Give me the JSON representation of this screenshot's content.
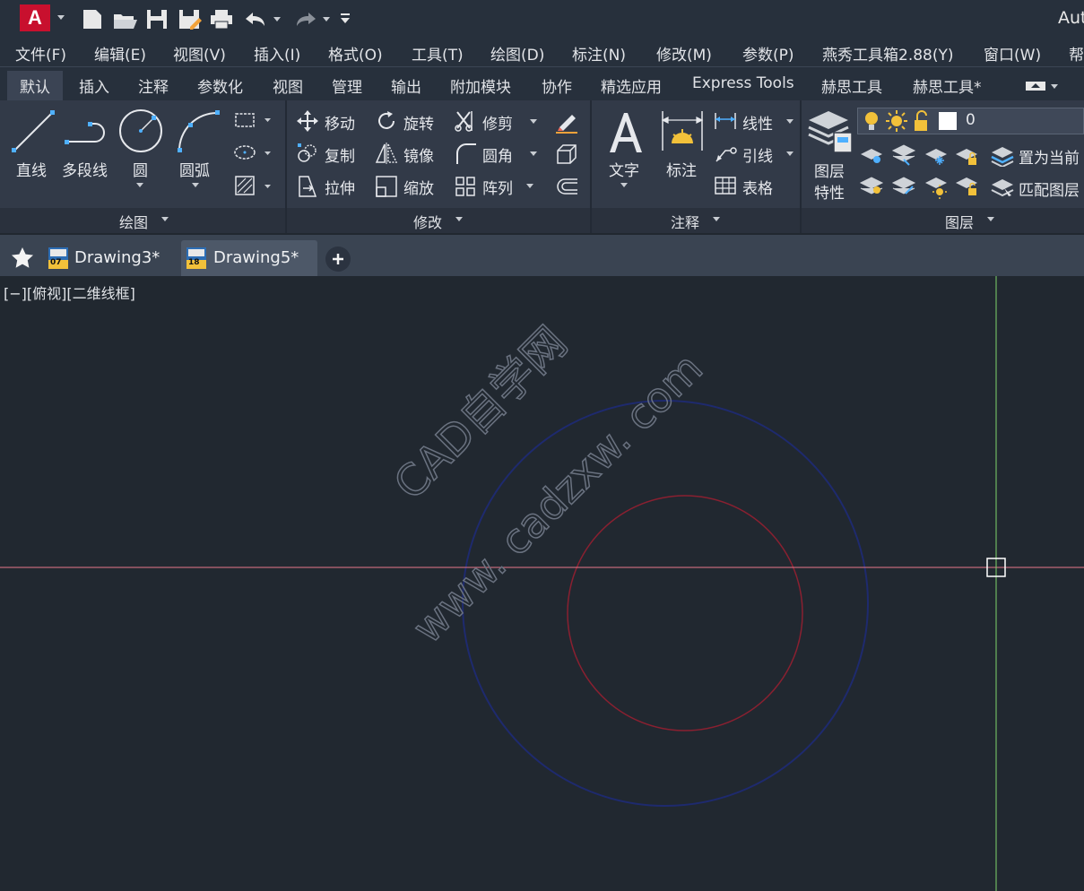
{
  "app": {
    "logo_letter": "A",
    "title": "Aut"
  },
  "colors": {
    "brand": "#c8102e",
    "canvas": "#212830",
    "ribbon": "#323a48",
    "cursor_h": "#e8788a",
    "cursor_v": "#7ed46a",
    "circle_outer": "#1e2a6e",
    "circle_inner": "#8a2030"
  },
  "menu": [
    "文件(F)",
    "编辑(E)",
    "视图(V)",
    "插入(I)",
    "格式(O)",
    "工具(T)",
    "绘图(D)",
    "标注(N)",
    "修改(M)",
    "参数(P)",
    "燕秀工具箱2.88(Y)",
    "窗口(W)",
    "帮"
  ],
  "ribbon_tabs": [
    "默认",
    "插入",
    "注释",
    "参数化",
    "视图",
    "管理",
    "输出",
    "附加模块",
    "协作",
    "精选应用",
    "Express Tools",
    "赫思工具",
    "赫思工具*"
  ],
  "draw_panel": {
    "title": "绘图",
    "items": [
      "直线",
      "多段线",
      "圆",
      "圆弧"
    ]
  },
  "modify_panel": {
    "title": "修改",
    "items": [
      "移动",
      "旋转",
      "修剪",
      "复制",
      "镜像",
      "圆角",
      "拉伸",
      "缩放",
      "阵列"
    ]
  },
  "annotation_panel": {
    "title": "注释",
    "text": "文字",
    "dim": "标注",
    "linear": "线性",
    "leader": "引线",
    "table": "表格"
  },
  "layers_panel": {
    "title": "图层",
    "props_line1": "图层",
    "props_line2": "特性",
    "current_layer": "0",
    "set_current": "置为当前",
    "match_layer": "匹配图层"
  },
  "doc_tabs": [
    {
      "name": "Drawing3*",
      "badge": "07",
      "active": false
    },
    {
      "name": "Drawing5*",
      "badge": "18",
      "active": true
    }
  ],
  "viewport": {
    "label": "[−][俯视][二维线框]"
  },
  "watermark": {
    "line1": "CAD自学网",
    "line2": "www. cadzxw. com"
  }
}
